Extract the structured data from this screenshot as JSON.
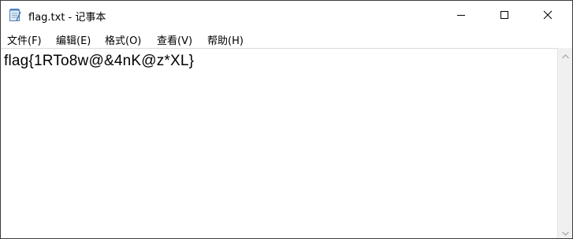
{
  "window": {
    "title": "flag.txt - 记事本",
    "icon": "notepad-icon"
  },
  "controls": {
    "minimize_icon": "minimize-icon",
    "maximize_icon": "maximize-icon",
    "close_icon": "close-icon"
  },
  "menu": {
    "file": "文件(F)",
    "edit": "编辑(E)",
    "format": "格式(O)",
    "view": "查看(V)",
    "help": "帮助(H)"
  },
  "editor": {
    "content": "flag{1RTo8w@&4nK@z*XL}"
  },
  "scrollbar": {
    "up_icon": "scroll-up-arrow-icon",
    "down_icon": "scroll-down-arrow-icon"
  }
}
